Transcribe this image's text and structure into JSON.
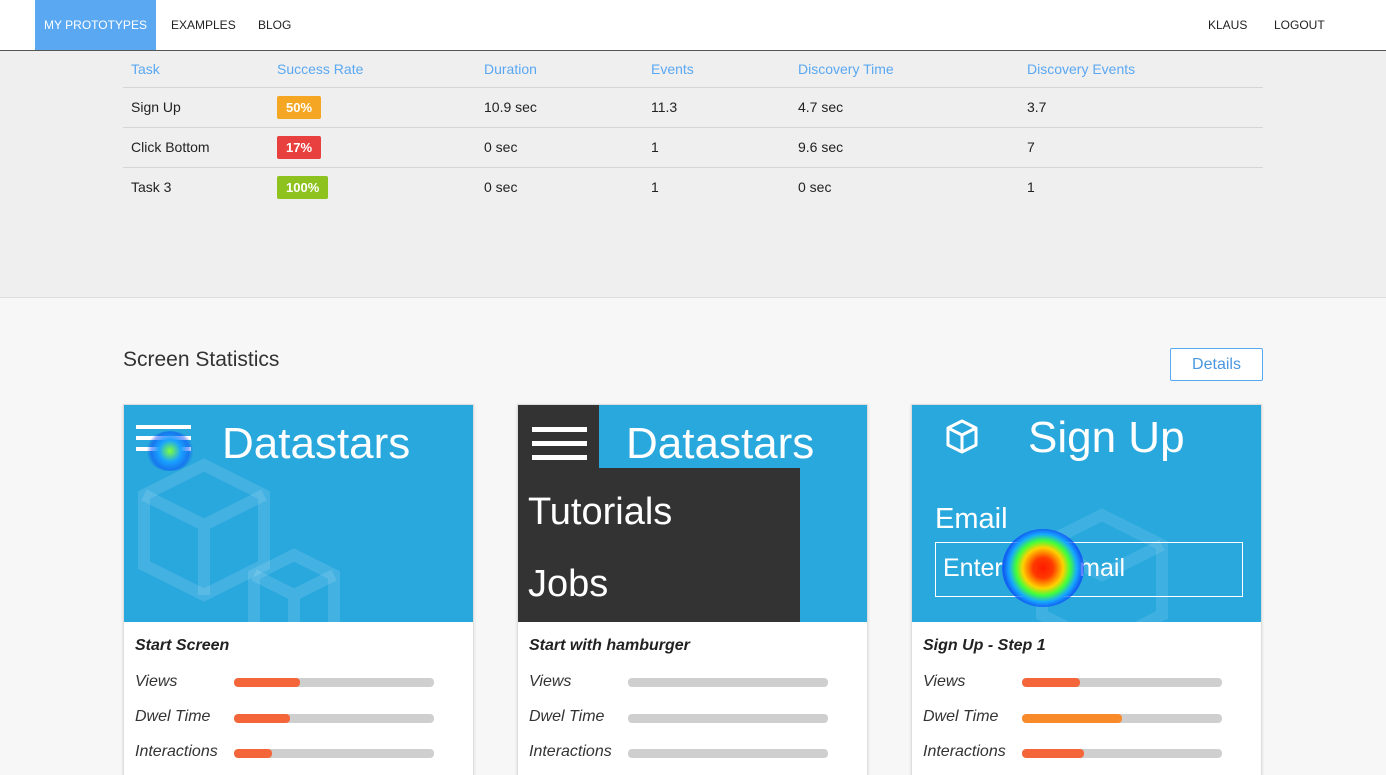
{
  "nav": {
    "left": [
      "MY PROTOTYPES",
      "EXAMPLES",
      "BLOG"
    ],
    "right": [
      "KLAUS",
      "LOGOUT"
    ]
  },
  "tasks": {
    "headers": [
      "Task",
      "Success Rate",
      "Duration",
      "Events",
      "Discovery Time",
      "Discovery Events"
    ],
    "rows": [
      {
        "task": "Sign Up",
        "rate": "50%",
        "rate_color": "#f5a623",
        "duration": "10.9 sec",
        "events": "11.3",
        "discovery_time": "4.7 sec",
        "discovery_events": "3.7"
      },
      {
        "task": "Click Bottom",
        "rate": "17%",
        "rate_color": "#e8403f",
        "duration": "0 sec",
        "events": "1",
        "discovery_time": "9.6 sec",
        "discovery_events": "7"
      },
      {
        "task": "Task 3",
        "rate": "100%",
        "rate_color": "#8ec21e",
        "duration": "0 sec",
        "events": "1",
        "discovery_time": "0 sec",
        "discovery_events": "1"
      }
    ]
  },
  "screen_stats": {
    "title": "Screen Statistics",
    "details_label": "Details",
    "stat_labels": [
      "Views",
      "Dwel Time",
      "Interactions"
    ],
    "cards": [
      {
        "name": "Start Screen",
        "thumb_title": "Datastars",
        "views": 0.33,
        "dwell": 0.28,
        "interactions": 0.19,
        "dwell_color": "#f4663a"
      },
      {
        "name": "Start with hamburger",
        "thumb_title": "Datastars",
        "menu_items": [
          "Tutorials",
          "Jobs"
        ],
        "views": 0,
        "dwell": 0,
        "interactions": 0,
        "dwell_color": "#f4663a"
      },
      {
        "name": "Sign Up - Step 1",
        "thumb_title": "Sign Up",
        "email_label": "Email",
        "email_placeholder": "Enter your email",
        "views": 0.29,
        "dwell": 0.5,
        "interactions": 0.31,
        "dwell_color": "#f98a2a"
      }
    ]
  },
  "colors": {
    "accent": "#5aa8f2",
    "thumb_bg": "#29a8de",
    "bar_fill": "#f4663a",
    "menu_dark": "#333333"
  }
}
